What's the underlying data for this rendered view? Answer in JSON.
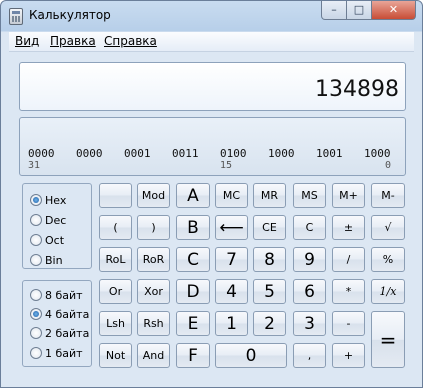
{
  "window": {
    "title": "Калькулятор",
    "controls": {
      "minimize": "–",
      "maximize": "□",
      "close": "✕"
    }
  },
  "menu": {
    "items": [
      {
        "label": "Вид"
      },
      {
        "label": "Правка"
      },
      {
        "label": "Справка"
      }
    ]
  },
  "display": {
    "value": "134898"
  },
  "binary": {
    "groups": [
      "0000",
      "0000",
      "0001",
      "0011",
      "0100",
      "1000",
      "1001",
      "1000"
    ],
    "positions": [
      "31",
      "15",
      "0"
    ]
  },
  "base_radios": [
    {
      "label": "Hex",
      "checked": true
    },
    {
      "label": "Dec",
      "checked": false
    },
    {
      "label": "Oct",
      "checked": false
    },
    {
      "label": "Bin",
      "checked": false
    }
  ],
  "word_radios": [
    {
      "label": "8 байт",
      "checked": false
    },
    {
      "label": "4 байта",
      "checked": true
    },
    {
      "label": "2 байта",
      "checked": false
    },
    {
      "label": "1 байт",
      "checked": false
    }
  ],
  "keys": {
    "blank": "",
    "mod": "Mod",
    "a": "A",
    "mc": "MC",
    "mr": "MR",
    "ms": "MS",
    "mplus": "M+",
    "mminus": "M-",
    "lparen": "(",
    "rparen": ")",
    "b": "B",
    "back": "⟵",
    "ce": "CE",
    "c": "C",
    "plusminus": "±",
    "sqrt": "√",
    "rol": "RoL",
    "ror": "RoR",
    "c_hex": "C",
    "n7": "7",
    "n8": "8",
    "n9": "9",
    "div": "/",
    "pct": "%",
    "or": "Or",
    "xor": "Xor",
    "d": "D",
    "n4": "4",
    "n5": "5",
    "n6": "6",
    "mul": "*",
    "recip": "1/x",
    "lsh": "Lsh",
    "rsh": "Rsh",
    "e": "E",
    "n1": "1",
    "n2": "2",
    "n3": "3",
    "sub": "-",
    "eq": "=",
    "not": "Not",
    "and": "And",
    "f": "F",
    "n0": "0",
    "dot": ",",
    "add": "+"
  }
}
